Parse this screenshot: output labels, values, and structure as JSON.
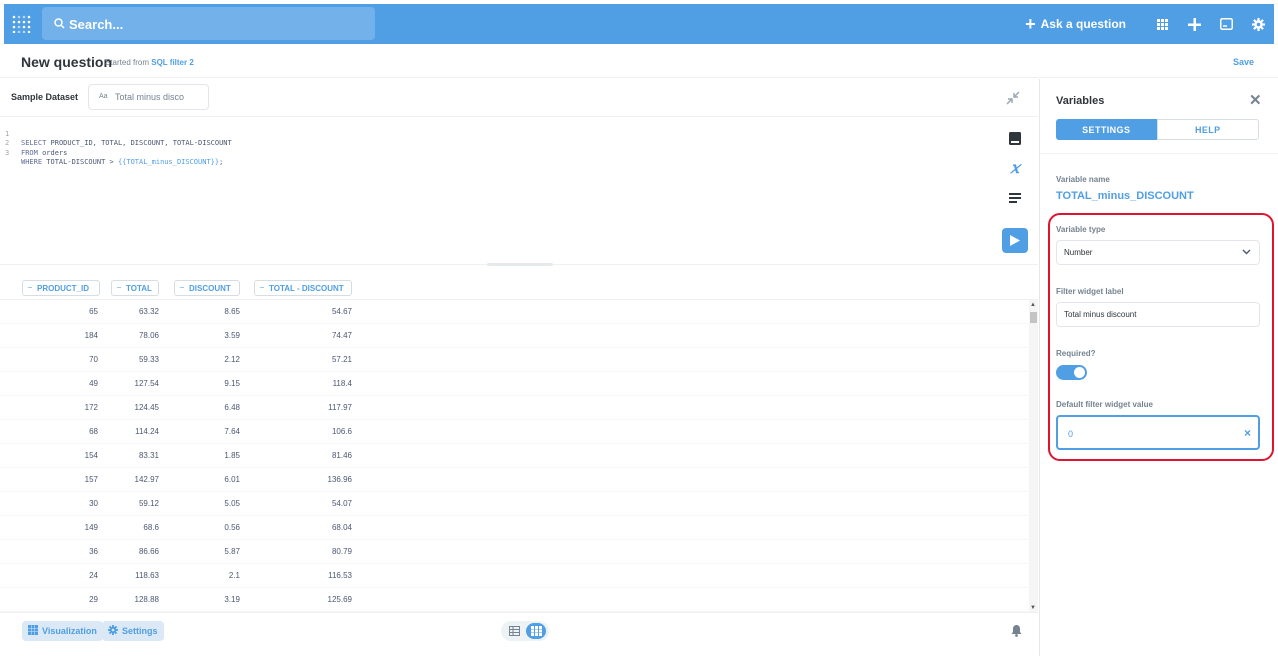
{
  "topnav": {
    "search_placeholder": "Search...",
    "ask_label": "Ask a question",
    "accent": "#509ee3"
  },
  "header": {
    "title": "New question",
    "started_prefix": "Started from",
    "source": "SQL filter 2",
    "save_label": "Save"
  },
  "editor": {
    "dataset": "Sample Dataset",
    "widget_type": "Aa",
    "widget_value": "Total minus disco",
    "lines": [
      {
        "n": "1",
        "kw": "SELECT",
        "rest": " PRODUCT_ID, TOTAL, DISCOUNT, TOTAL-DISCOUNT",
        "var": ""
      },
      {
        "n": "2",
        "kw": "FROM",
        "rest": " orders",
        "var": ""
      },
      {
        "n": "3",
        "kw": "WHERE",
        "rest": " TOTAL-DISCOUNT > ",
        "var": "{{TOTAL_minus_DISCOUNT}}",
        "tail": ";"
      }
    ]
  },
  "table": {
    "columns": [
      "PRODUCT_ID",
      "TOTAL",
      "DISCOUNT",
      "TOTAL - DISCOUNT"
    ],
    "rows": [
      [
        "65",
        "63.32",
        "8.65",
        "54.67"
      ],
      [
        "184",
        "78.06",
        "3.59",
        "74.47"
      ],
      [
        "70",
        "59.33",
        "2.12",
        "57.21"
      ],
      [
        "49",
        "127.54",
        "9.15",
        "118.4"
      ],
      [
        "172",
        "124.45",
        "6.48",
        "117.97"
      ],
      [
        "68",
        "114.24",
        "7.64",
        "106.6"
      ],
      [
        "154",
        "83.31",
        "1.85",
        "81.46"
      ],
      [
        "157",
        "142.97",
        "6.01",
        "136.96"
      ],
      [
        "30",
        "59.12",
        "5.05",
        "54.07"
      ],
      [
        "149",
        "68.6",
        "0.56",
        "68.04"
      ],
      [
        "36",
        "86.66",
        "5.87",
        "80.79"
      ],
      [
        "24",
        "118.63",
        "2.1",
        "116.53"
      ],
      [
        "29",
        "128.88",
        "3.19",
        "125.69"
      ]
    ]
  },
  "footer": {
    "visualization_label": "Visualization",
    "settings_label": "Settings"
  },
  "panel": {
    "title": "Variables",
    "tabs": [
      "SETTINGS",
      "HELP"
    ],
    "variable_name_label": "Variable name",
    "variable_name": "TOTAL_minus_DISCOUNT",
    "variable_type_label": "Variable type",
    "variable_type": "Number",
    "filter_label_label": "Filter widget label",
    "filter_label": "Total minus discount",
    "required_label": "Required?",
    "required": true,
    "default_label": "Default filter widget value",
    "default_value": "0",
    "highlight_color": "#e0142c"
  }
}
